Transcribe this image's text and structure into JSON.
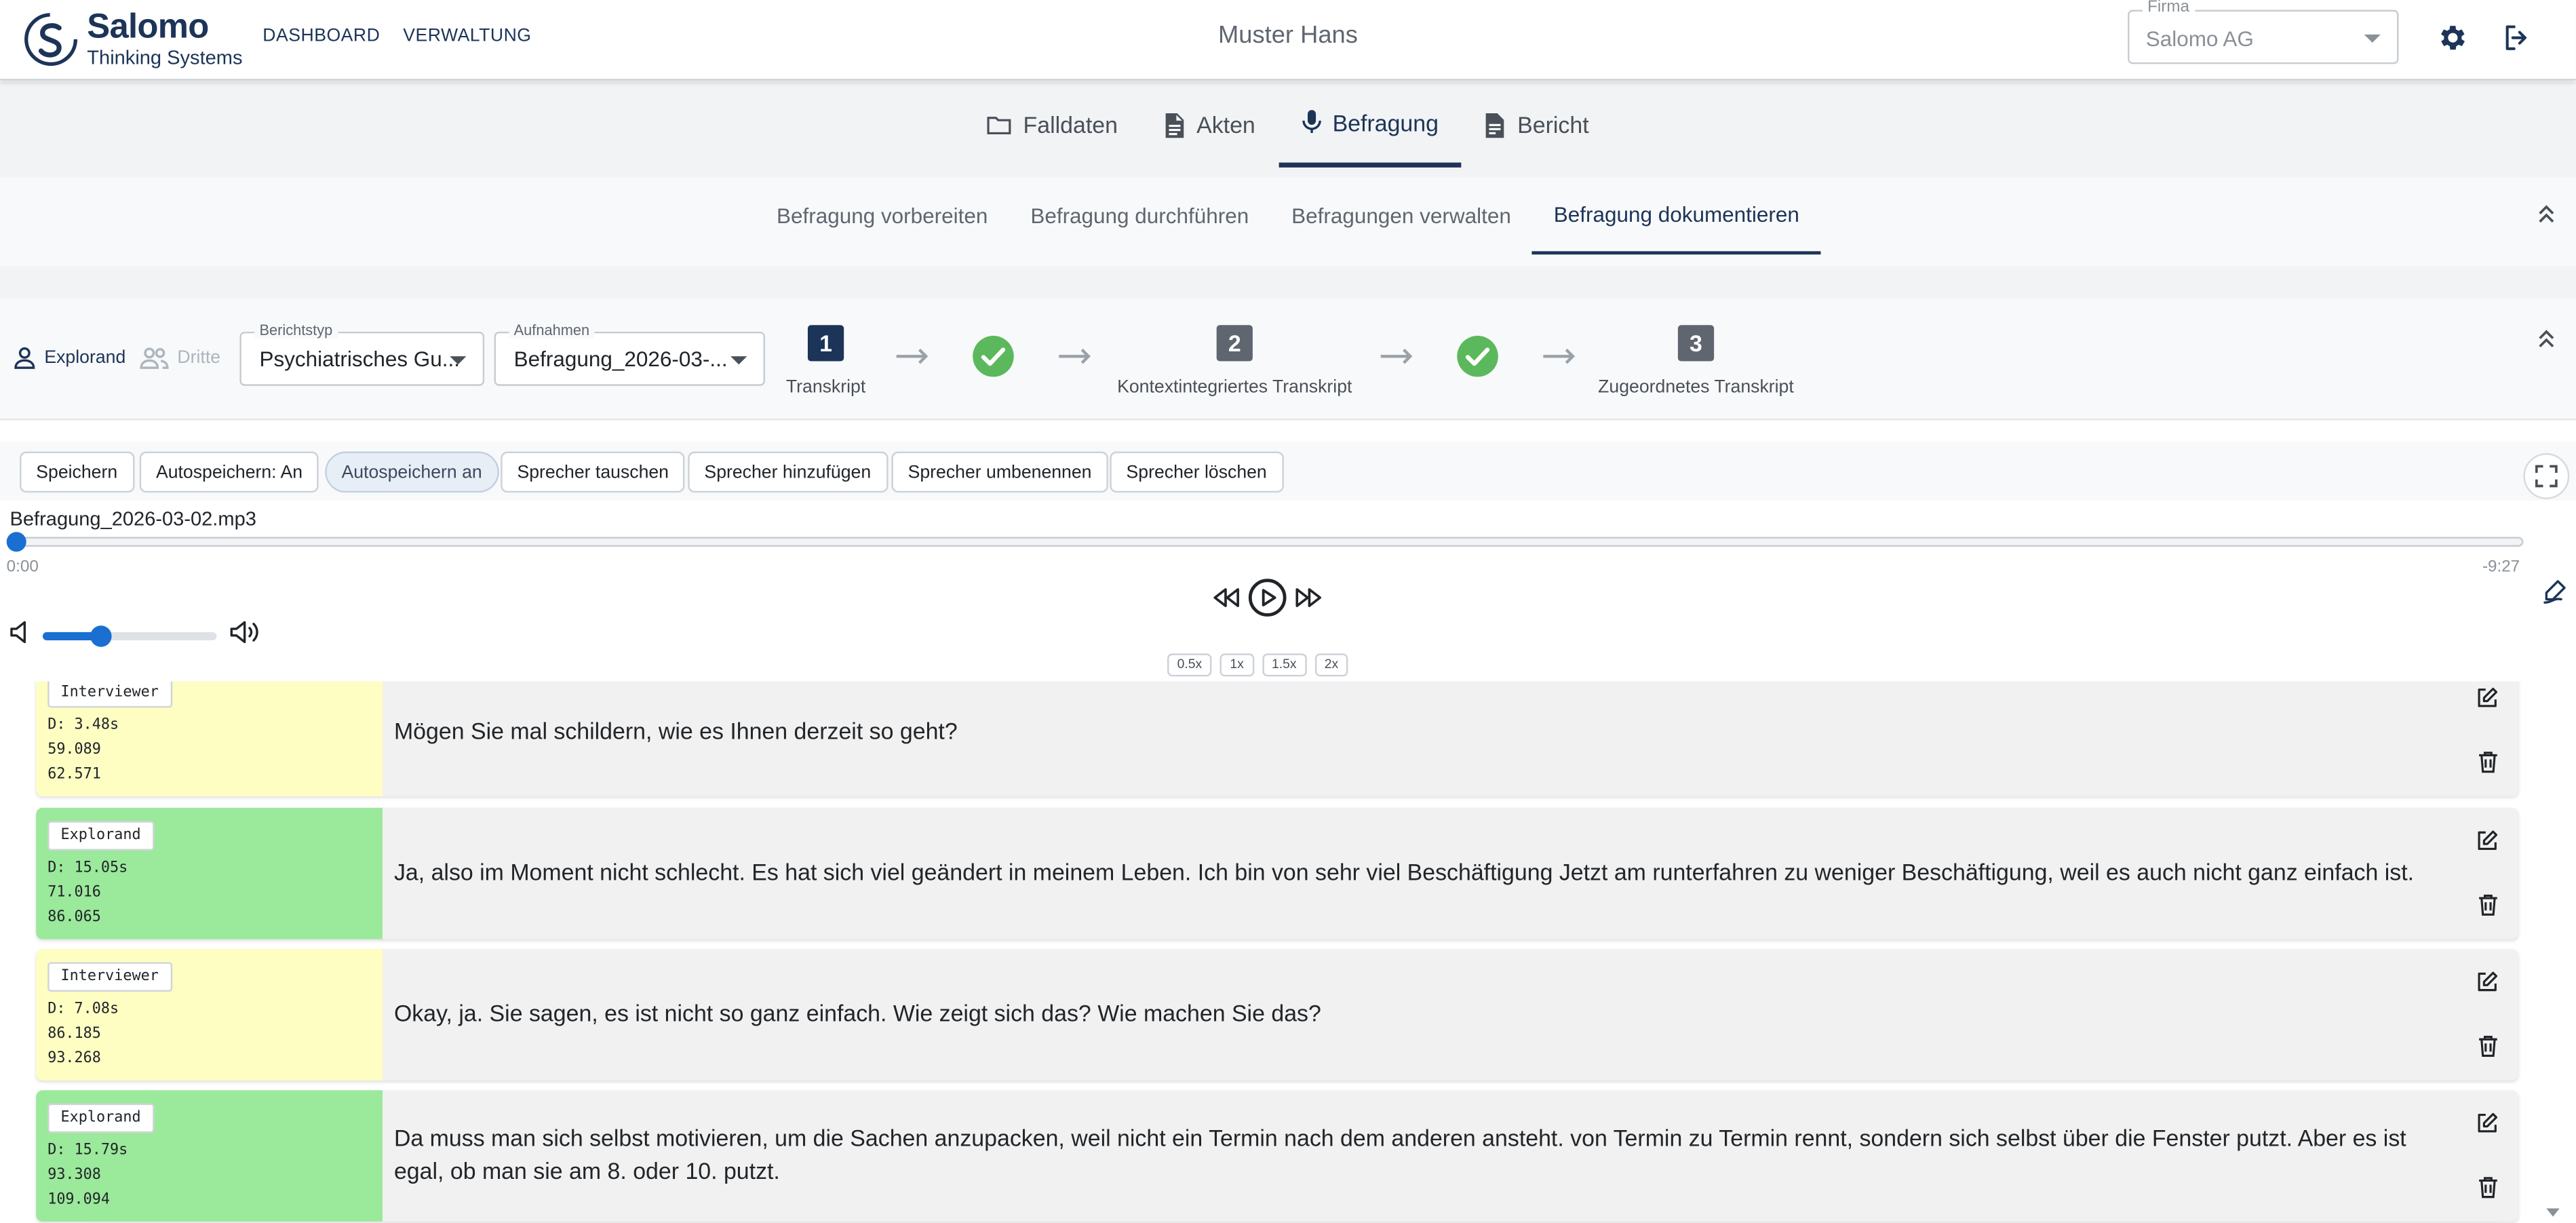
{
  "app": {
    "brand": "Salomo",
    "tagline": "Thinking Systems"
  },
  "topnav": [
    "DASHBOARD",
    "VERWALTUNG"
  ],
  "user": "Muster Hans",
  "firma": {
    "label": "Firma",
    "value": "Salomo AG"
  },
  "main_tabs": [
    {
      "label": "Falldaten",
      "icon": "folder-icon"
    },
    {
      "label": "Akten",
      "icon": "document-icon"
    },
    {
      "label": "Befragung",
      "icon": "microphone-icon",
      "active": true
    },
    {
      "label": "Bericht",
      "icon": "report-icon"
    }
  ],
  "sub_tabs": [
    {
      "label": "Befragung vorbereiten"
    },
    {
      "label": "Befragung durchführen"
    },
    {
      "label": "Befragungen verwalten"
    },
    {
      "label": "Befragung dokumentieren",
      "active": true
    }
  ],
  "parties": {
    "explorand": "Explorand",
    "dritte": "Dritte"
  },
  "berichtstyp": {
    "label": "Berichtstyp",
    "value": "Psychiatrisches Gu..."
  },
  "aufnahmen": {
    "label": "Aufnahmen",
    "value": "Befragung_2026-03-..."
  },
  "steps": [
    {
      "num": "1",
      "label": "Transkript",
      "color": "#1c3458"
    },
    {
      "num": "2",
      "label": "Kontextintegriertes Transkript",
      "color": "#5f6670"
    },
    {
      "num": "3",
      "label": "Zugeordnetes Transkript",
      "color": "#5f6670"
    }
  ],
  "toolbar": {
    "save": "Speichern",
    "autosave_toggle": "Autospeichern: An",
    "autosave_chip": "Autospeichern an",
    "swap_speaker": "Sprecher tauschen",
    "add_speaker": "Sprecher hinzufügen",
    "rename_speaker": "Sprecher umbenennen",
    "delete_speaker": "Sprecher löschen"
  },
  "player": {
    "filename": "Befragung_2026-03-02.mp3",
    "current_time": "0:00",
    "remaining_time": "-9:27",
    "progress": 0,
    "volume": 0.33,
    "speeds": [
      "0.5x",
      "1x",
      "1.5x",
      "2x"
    ]
  },
  "segments": [
    {
      "speaker": "Interviewer",
      "duration": "D: 3.48s",
      "start": "59.089",
      "end": "62.571",
      "text": "Mögen Sie mal schildern, wie es Ihnen derzeit so geht?"
    },
    {
      "speaker": "Explorand",
      "duration": "D: 15.05s",
      "start": "71.016",
      "end": "86.065",
      "text": "Ja, also im Moment nicht schlecht. Es hat sich viel geändert in meinem Leben. Ich bin von sehr viel Beschäftigung Jetzt am runterfahren zu weniger Beschäftigung, weil es auch nicht ganz einfach ist."
    },
    {
      "speaker": "Interviewer",
      "duration": "D: 7.08s",
      "start": "86.185",
      "end": "93.268",
      "text": "Okay, ja. Sie sagen, es ist nicht so ganz einfach. Wie zeigt sich das? Wie machen Sie das?"
    },
    {
      "speaker": "Explorand",
      "duration": "D: 15.79s",
      "start": "93.308",
      "end": "109.094",
      "text": "Da muss man sich selbst motivieren, um die Sachen anzupacken, weil nicht ein Termin nach dem anderen ansteht. von Termin zu Termin rennt, sondern sich selbst über die Fenster putzt. Aber es ist egal, ob man sie am 8. oder 10. putzt."
    }
  ],
  "colors": {
    "primary": "#1c3458",
    "interviewer_bg": "#fefec3",
    "explorand_bg": "#9be99b",
    "accent": "#1a6fd1",
    "check": "#5cb85c"
  }
}
